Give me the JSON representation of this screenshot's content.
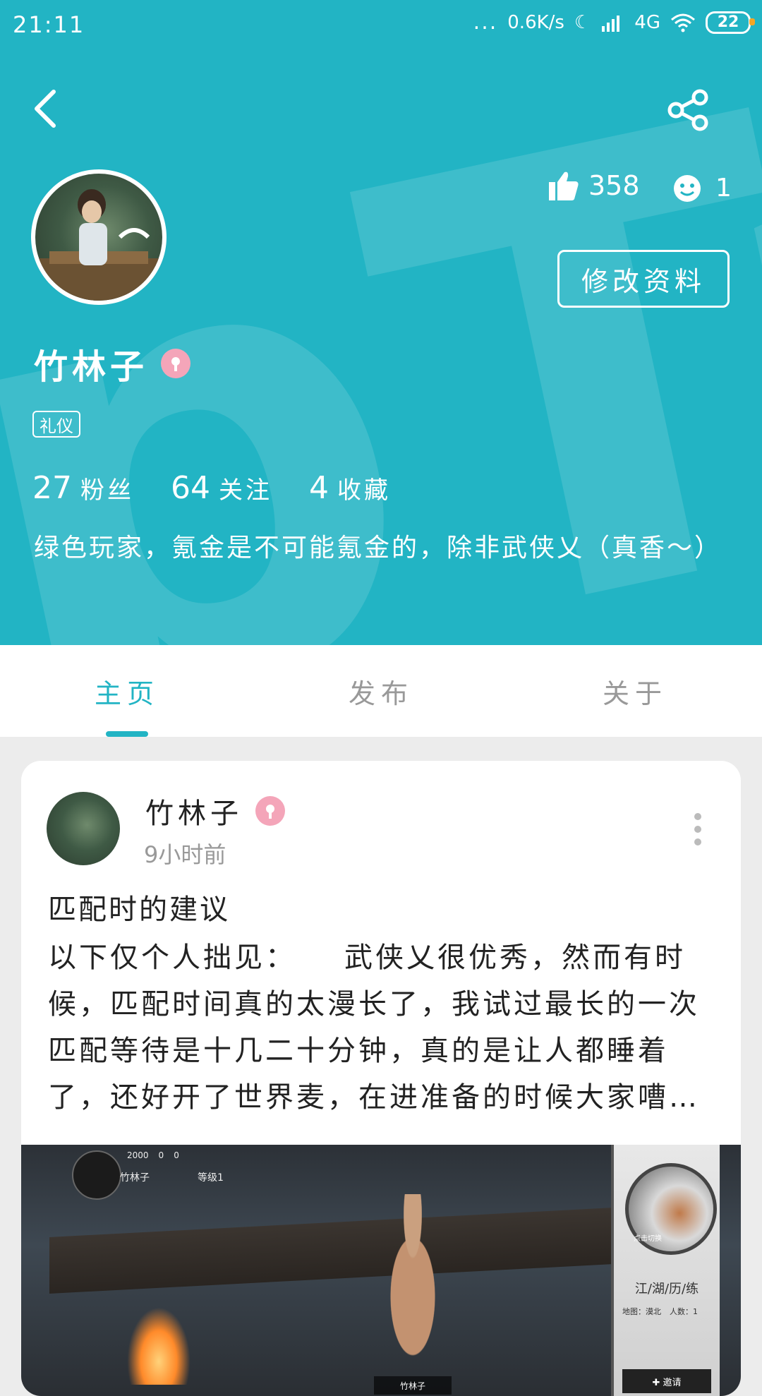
{
  "status_bar": {
    "time": "21:11",
    "dots": "...",
    "net_speed": "0.6K/s",
    "network": "4G",
    "battery": "22"
  },
  "profile": {
    "likes": "358",
    "reactions": "1",
    "edit_button": "修改资料",
    "username": "竹林子",
    "tag": "礼仪",
    "stats": [
      {
        "num": "27",
        "label": "粉丝"
      },
      {
        "num": "64",
        "label": "关注"
      },
      {
        "num": "4",
        "label": "收藏"
      }
    ],
    "bio": "绿色玩家，氪金是不可能氪金的，除非武侠乂（真香～）"
  },
  "tabs": [
    {
      "label": "主页",
      "active": true
    },
    {
      "label": "发布",
      "active": false
    },
    {
      "label": "关于",
      "active": false
    }
  ],
  "post": {
    "author": "竹林子",
    "time": "9小时前",
    "title": "匹配时的建议",
    "body": "以下仅个人拙见：　　武侠乂很优秀，然而有时候，匹配时间真的太漫长了，我试过最长的一次匹配等待是十几二十分钟，真的是让人都睡着了，还好开了世界麦，在进准备的时候大家嘈…",
    "image": {
      "coins": [
        "2000",
        "0",
        "0"
      ],
      "player_name": "竹林子",
      "level": "等级1",
      "portal_text": "点击切换",
      "panel_title": "江/湖/历/练",
      "map_label": "地图：漠北",
      "people_label": "人数：1",
      "invite_label": "✚ 邀请",
      "nameplate": "竹林子"
    }
  },
  "colors": {
    "accent": "#22b4c4",
    "background": "#ececec",
    "badge": "#f4a5b9"
  }
}
